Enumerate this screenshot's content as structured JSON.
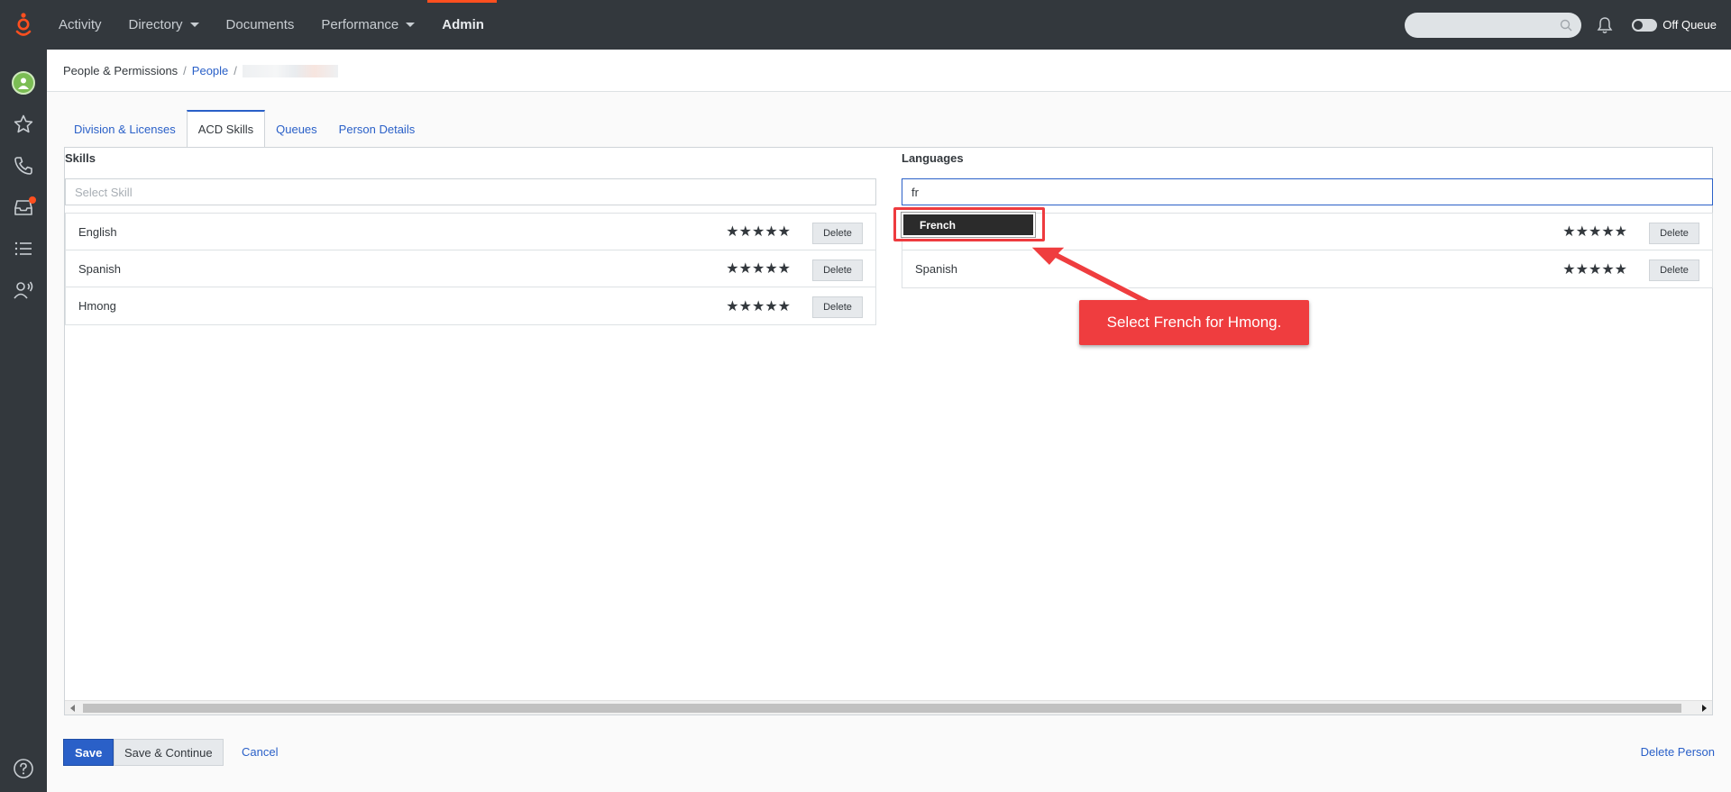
{
  "topbar": {
    "nav": [
      {
        "label": "Activity",
        "dropdown": false
      },
      {
        "label": "Directory",
        "dropdown": true
      },
      {
        "label": "Documents",
        "dropdown": false
      },
      {
        "label": "Performance",
        "dropdown": true
      },
      {
        "label": "Admin",
        "dropdown": false,
        "active": true
      }
    ],
    "queue_status": "Off Queue"
  },
  "rail": {
    "icons": [
      "avatar-icon",
      "star-icon",
      "phone-icon",
      "inbox-icon",
      "list-icon",
      "contacts-icon",
      "help-icon"
    ]
  },
  "breadcrumb": {
    "root": "People & Permissions",
    "people": "People"
  },
  "tabs": [
    {
      "label": "Division & Licenses"
    },
    {
      "label": "ACD Skills",
      "active": true
    },
    {
      "label": "Queues"
    },
    {
      "label": "Person Details"
    }
  ],
  "skills": {
    "title": "Skills",
    "placeholder": "Select Skill",
    "rows": [
      {
        "name": "English",
        "stars": "★★★★★",
        "delete_label": "Delete"
      },
      {
        "name": "Spanish",
        "stars": "★★★★★",
        "delete_label": "Delete"
      },
      {
        "name": "Hmong",
        "stars": "★★★★★",
        "delete_label": "Delete"
      }
    ]
  },
  "languages": {
    "title": "Languages",
    "input_value": "fr",
    "dropdown_option": "French",
    "rows": [
      {
        "name": "",
        "stars": "★★★★★",
        "delete_label": "Delete"
      },
      {
        "name": "Spanish",
        "stars": "★★★★★",
        "delete_label": "Delete"
      }
    ]
  },
  "footer": {
    "save_label": "Save",
    "save_continue_label": "Save & Continue",
    "cancel_label": "Cancel",
    "delete_person_label": "Delete Person"
  },
  "annotation": {
    "callout_text": "Select French for Hmong.",
    "color": "#ef3d3f"
  },
  "colors": {
    "topbar": "#33383d",
    "accent": "#ff4f1f",
    "link": "#2a60c8"
  }
}
